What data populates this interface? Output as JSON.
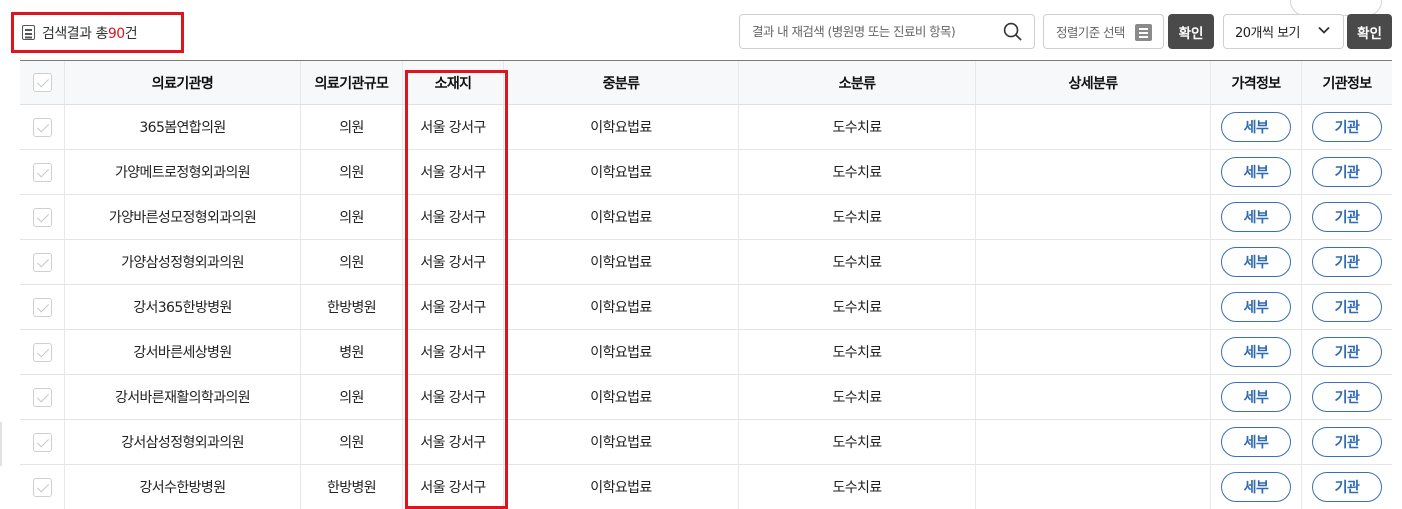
{
  "summary": {
    "prefix": "검색결과 총",
    "count": "90",
    "suffix": "건"
  },
  "toolbar": {
    "search_placeholder": "결과 내 재검색 (병원명 또는 진료비 항목)",
    "search_value": "",
    "sort_label": "정렬기준 선택",
    "confirm_label": "확인",
    "page_size_label": "20개씩 보기",
    "confirm2_label": "확인"
  },
  "table": {
    "headers": [
      "",
      "의료기관명",
      "의료기관규모",
      "소재지",
      "중분류",
      "소분류",
      "상세분류",
      "가격정보",
      "기관정보"
    ],
    "detail_button": "세부",
    "institution_button": "기관",
    "rows": [
      {
        "name": "365봄연합의원",
        "size": "의원",
        "location": "서울 강서구",
        "mid": "이학요법료",
        "sub": "도수치료",
        "detail": ""
      },
      {
        "name": "가양메트로정형외과의원",
        "size": "의원",
        "location": "서울 강서구",
        "mid": "이학요법료",
        "sub": "도수치료",
        "detail": ""
      },
      {
        "name": "가양바른성모정형외과의원",
        "size": "의원",
        "location": "서울 강서구",
        "mid": "이학요법료",
        "sub": "도수치료",
        "detail": ""
      },
      {
        "name": "가양삼성정형외과의원",
        "size": "의원",
        "location": "서울 강서구",
        "mid": "이학요법료",
        "sub": "도수치료",
        "detail": ""
      },
      {
        "name": "강서365한방병원",
        "size": "한방병원",
        "location": "서울 강서구",
        "mid": "이학요법료",
        "sub": "도수치료",
        "detail": ""
      },
      {
        "name": "강서바른세상병원",
        "size": "병원",
        "location": "서울 강서구",
        "mid": "이학요법료",
        "sub": "도수치료",
        "detail": ""
      },
      {
        "name": "강서바른재활의학과의원",
        "size": "의원",
        "location": "서울 강서구",
        "mid": "이학요법료",
        "sub": "도수치료",
        "detail": ""
      },
      {
        "name": "강서삼성정형외과의원",
        "size": "의원",
        "location": "서울 강서구",
        "mid": "이학요법료",
        "sub": "도수치료",
        "detail": ""
      },
      {
        "name": "강서수한방병원",
        "size": "한방병원",
        "location": "서울 강서구",
        "mid": "이학요법료",
        "sub": "도수치료",
        "detail": ""
      }
    ]
  },
  "colors": {
    "highlight": "#e0141e",
    "accent_blue": "#2f6ab3",
    "dark_button": "#4a4a4a"
  },
  "icons": {
    "summary": "document-icon",
    "search": "search-icon",
    "sort": "list-icon",
    "page_size": "chevron-down-icon",
    "row_select": "checkbox-icon"
  }
}
